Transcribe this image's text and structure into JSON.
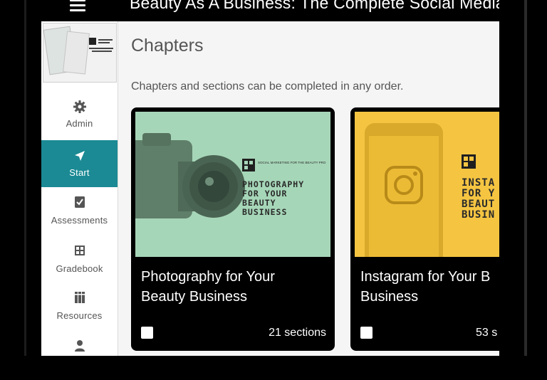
{
  "header": {
    "course_title": "Beauty As A Business: The Complete Social Media Course"
  },
  "sidebar": {
    "items": [
      {
        "label": "Admin",
        "icon": "gear-icon"
      },
      {
        "label": "Start",
        "icon": "navigation-arrow-icon",
        "active": true
      },
      {
        "label": "Assessments",
        "icon": "checklist-icon"
      },
      {
        "label": "Gradebook",
        "icon": "gradebook-icon"
      },
      {
        "label": "Resources",
        "icon": "books-icon"
      },
      {
        "label": "",
        "icon": "person-icon"
      }
    ]
  },
  "main": {
    "title": "Chapters",
    "description": "Chapters and sections can be completed in any order.",
    "cards": [
      {
        "title_line1": "Photography for Your",
        "title_line2": "Beauty Business",
        "sections": "21 sections",
        "image": {
          "brand_text": "SOCIAL MARKETING FOR THE BEAUTY PRO",
          "line1": "PHOTOGRAPHY",
          "line2": "FOR YOUR",
          "line3": "BEAUTY",
          "line4": "BUSINESS",
          "background": "#a6d6b8"
        }
      },
      {
        "title_line1": "Instagram for Your B",
        "title_line2": "Business",
        "sections": "53 s",
        "image": {
          "line1": "INSTA",
          "line2": "FOR Y",
          "line3": "BEAUT",
          "line4": "BUSIN",
          "background": "#f5c542"
        }
      }
    ]
  },
  "colors": {
    "accent": "#1b8a94",
    "frame": "#000000",
    "card_bg": "#000000",
    "main_bg": "#f5f5f5"
  }
}
